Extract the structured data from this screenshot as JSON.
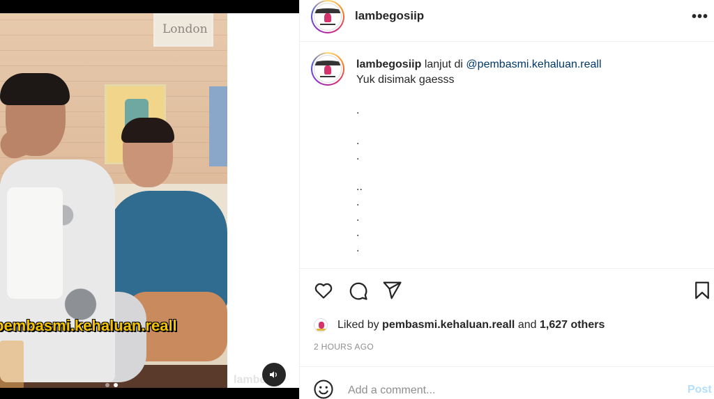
{
  "media": {
    "overlay_text": "pembasmi.kehaluan.reall",
    "poster_text": "London",
    "watermark": "lambe...",
    "carousel_count": 2,
    "carousel_active_index": 1
  },
  "post": {
    "username": "lambegosiip",
    "more_icon": "more-horizontal-icon"
  },
  "caption": {
    "username": "lambegosiip",
    "text_before_mention": "lanjut di",
    "mention": "@pembasmi.kehaluan.reall",
    "line2": "Yuk disimak gaesss",
    "dot_lines": [
      "",
      ".",
      "",
      ".",
      ".",
      "",
      "..",
      ".",
      ".",
      ".",
      "."
    ]
  },
  "actions": {
    "like_icon": "heart-icon",
    "comment_icon": "comment-icon",
    "share_icon": "send-icon",
    "save_icon": "bookmark-icon"
  },
  "likes": {
    "prefix": "Liked by",
    "user": "pembasmi.kehaluan.reall",
    "and": "and",
    "count": "1,627 others"
  },
  "timestamp": "2 HOURS AGO",
  "comment": {
    "placeholder": "Add a comment...",
    "post_label": "Post"
  },
  "colors": {
    "mention": "#00376b",
    "overlay_text": "#f4c400",
    "post_button": "#b2dffc",
    "muted_text": "#8e8e8e"
  }
}
